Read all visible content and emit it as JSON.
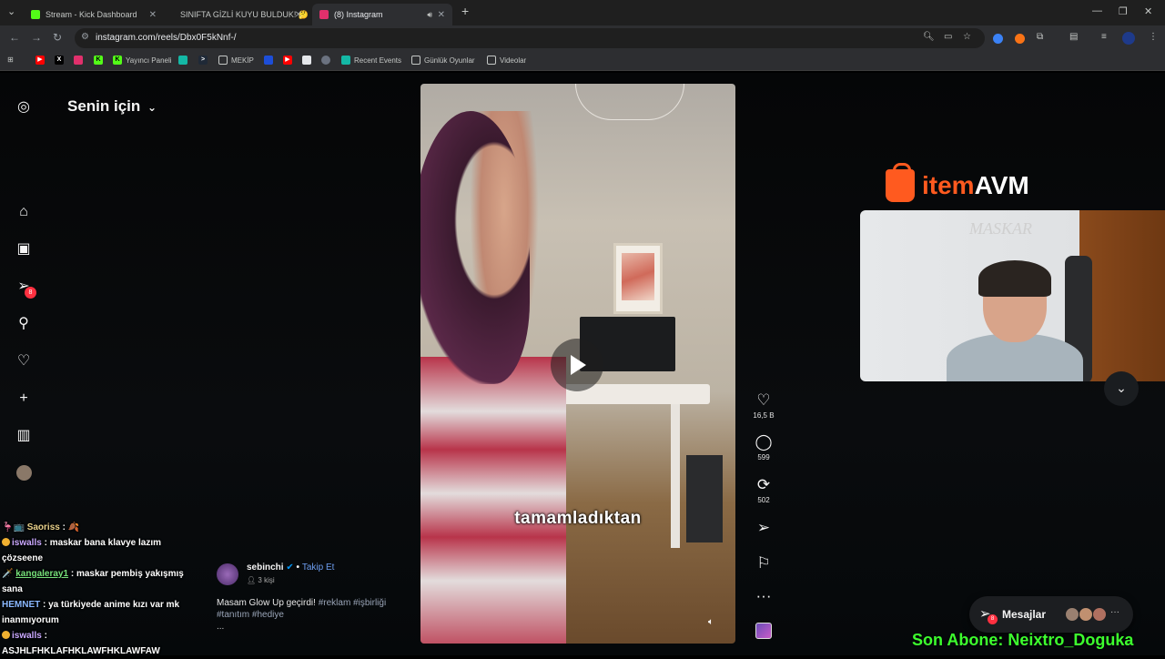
{
  "browser": {
    "tabs": [
      {
        "label": "Stream - Kick Dashboard",
        "color": "#53fc18"
      },
      {
        "label": "SINIFTA GİZLİ KUYU BULDUK! 🤔",
        "color": "#ff0000"
      },
      {
        "label": "(8) Instagram",
        "color": "#e1306c"
      }
    ],
    "url": "instagram.com/reels/Dbx0F5kNnf-/",
    "bookmarks": [
      "Yayıncı Paneli",
      "MEKİP",
      "Recent Events",
      "Günlük Oyunlar",
      "Videolar"
    ]
  },
  "sidebar": {
    "feed_title": "Senin için",
    "notif_count": "8"
  },
  "reel": {
    "caption_text": "tamamladıktan",
    "author": "sebinchi",
    "follow_label": "Takip Et",
    "audience": "3 kişi",
    "description": "Masam Glow Up geçirdi!",
    "tags": "#reklam #işbirliği #tanıtım #hediye",
    "more": "...",
    "likes": "16,5 B",
    "comments": "599",
    "reposts": "502"
  },
  "overlay": {
    "brand_a": "item",
    "brand_b": "AVM",
    "webcam_wall_text": "MASKAR",
    "messages_label": "Mesajlar",
    "messages_badge": "8",
    "sub_banner": "Son Abone: Neixtro_Doguka"
  },
  "chat": [
    {
      "user": "Saoriss",
      "text": ":"
    },
    {
      "user": "iswalls",
      "text": ": maskar bana klavye lazım çözseene"
    },
    {
      "user": "kangaleray1",
      "text": ": maskar pembiş yakışmış sana"
    },
    {
      "user": "HEMNET",
      "text": ": ya türkiyede anime kızı var mk inanmıyorum"
    },
    {
      "user": "iswalls",
      "text": ":"
    },
    {
      "user": "",
      "text": "ASJHLFHKLAFHKLAWFHKLAWFAW"
    }
  ]
}
